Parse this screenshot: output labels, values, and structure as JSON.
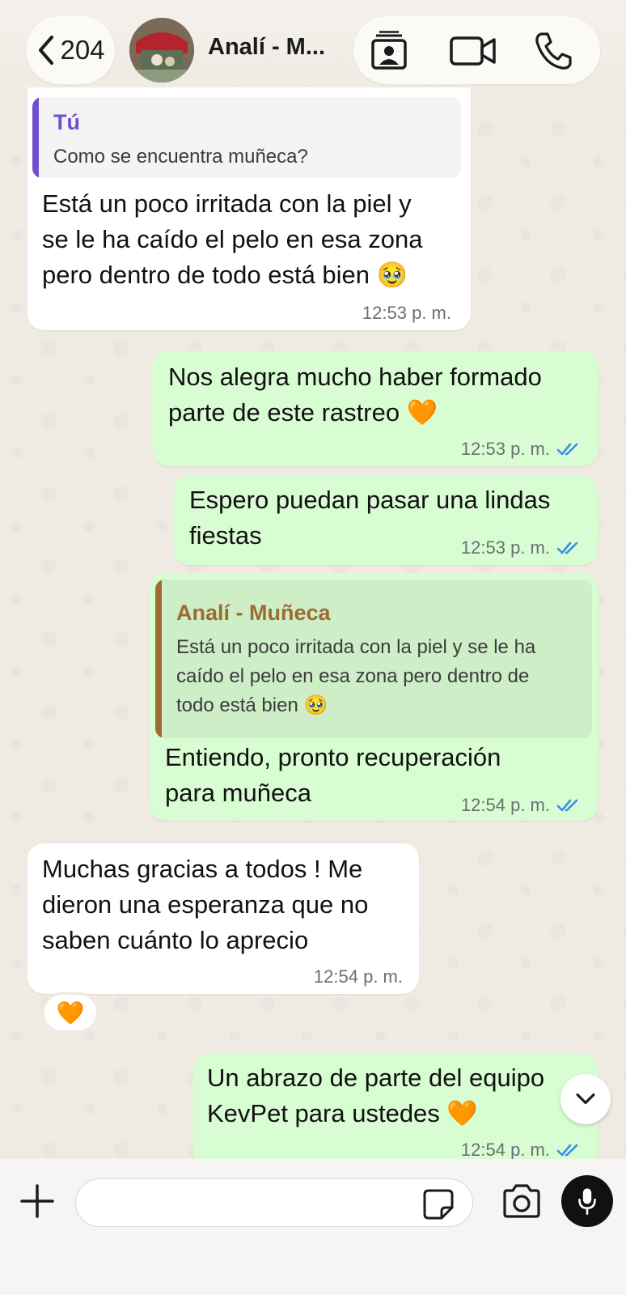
{
  "header": {
    "back_count": "204",
    "contact_name": "Analí - M...",
    "icons": [
      "chevron-left-icon",
      "contact-card-icon",
      "video-call-icon",
      "phone-call-icon"
    ]
  },
  "messages": [
    {
      "direction": "in",
      "quote": {
        "author": "Tú",
        "text": "Como se encuentra muñeca?"
      },
      "lines": [
        "Está un poco irritada con la piel y",
        "se le ha caído el pelo en esa zona",
        "pero dentro de todo está bien 🥹"
      ],
      "time": "12:53 p. m."
    },
    {
      "direction": "out",
      "lines": [
        "Nos alegra mucho haber formado",
        "parte de este rastreo 🧡"
      ],
      "time": "12:53 p. m."
    },
    {
      "direction": "out",
      "lines": [
        "Espero puedan pasar una lindas",
        "fiestas"
      ],
      "time": "12:53 p. m."
    },
    {
      "direction": "out",
      "quote": {
        "author": "Analí - Muñeca",
        "lines": [
          "Está un poco irritada con la piel y se le ha",
          "caído el pelo en esa zona pero dentro de",
          "todo está bien 🥹"
        ]
      },
      "lines": [
        "Entiendo, pronto recuperación",
        "para muñeca"
      ],
      "time": "12:54 p. m."
    },
    {
      "direction": "in",
      "lines": [
        "Muchas gracias a todos ! Me",
        "dieron una esperanza que no",
        "saben cuánto lo aprecio"
      ],
      "time": "12:54 p. m.",
      "reaction": "🧡"
    },
    {
      "direction": "out",
      "lines": [
        "Un abrazo de parte del equipo",
        "KevPet para ustedes 🧡"
      ],
      "time": "12:54 p. m."
    }
  ],
  "input_bar": {
    "placeholder": "",
    "icons": [
      "plus-icon",
      "sticker-icon",
      "camera-icon",
      "microphone-icon"
    ]
  },
  "colors": {
    "chat_background": "#efeae2",
    "incoming_bubble": "#ffffff",
    "outgoing_bubble": "#d9fdd3",
    "outgoing_quote_bg": "#cdeec6",
    "quote_you_color": "#6e4fcf",
    "quote_contact_color": "#9c6b30",
    "read_ticks": "#3b8ee8"
  }
}
